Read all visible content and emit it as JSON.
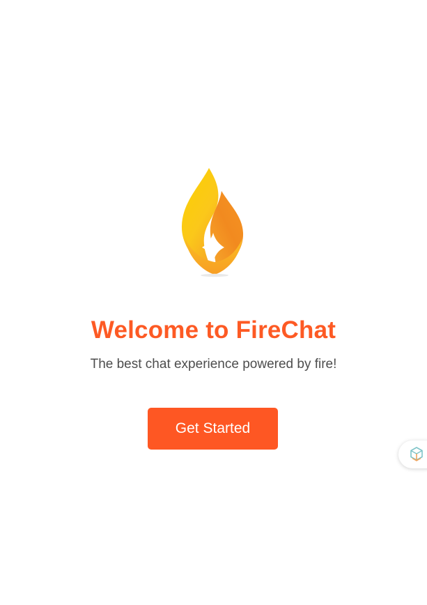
{
  "logo": {
    "icon": "flame-icon",
    "colors": {
      "yellow": "#f9d600",
      "orange": "#f6921e",
      "deep_orange": "#f07d18"
    }
  },
  "welcome": {
    "title": "Welcome to FireChat",
    "subtitle": "The best chat experience powered by fire!"
  },
  "cta": {
    "label": "Get Started"
  },
  "floating_widget": {
    "icon": "extension-widget-icon"
  },
  "colors": {
    "accent": "#fe5723",
    "title": "#fd5a24",
    "subtitle": "#4d4d4d",
    "background": "#ffffff"
  }
}
